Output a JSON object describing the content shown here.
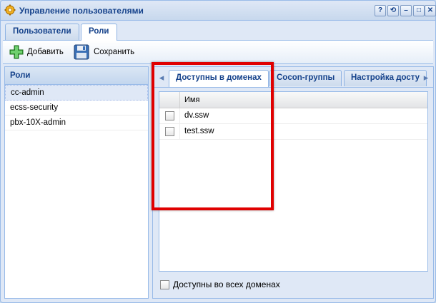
{
  "window": {
    "title": "Управление пользователями",
    "icon": "gear-icon",
    "tools": [
      "help-icon",
      "refresh-icon",
      "minimize-icon",
      "maximize-icon",
      "close-icon"
    ]
  },
  "main_tabs": [
    {
      "label": "Пользователи",
      "active": false
    },
    {
      "label": "Роли",
      "active": true
    }
  ],
  "toolbar": {
    "add_label": "Добавить",
    "save_label": "Сохранить"
  },
  "roles_panel": {
    "header": "Роли",
    "items": [
      "cc-admin",
      "ecss-security",
      "pbx-10X-admin"
    ],
    "selected_index": 0
  },
  "sub_tabs": [
    {
      "label": "Доступны в доменах",
      "active": true
    },
    {
      "label": "Cocon-группы",
      "active": false
    },
    {
      "label": "Настройка досту",
      "active": false
    }
  ],
  "grid": {
    "column_name": "Имя",
    "rows": [
      {
        "name": "dv.ssw",
        "checked": false
      },
      {
        "name": "test.ssw",
        "checked": false
      }
    ]
  },
  "all_domains_label": "Доступны во всех доменах",
  "colors": {
    "accent": "#15428b",
    "highlight": "#e00000"
  }
}
